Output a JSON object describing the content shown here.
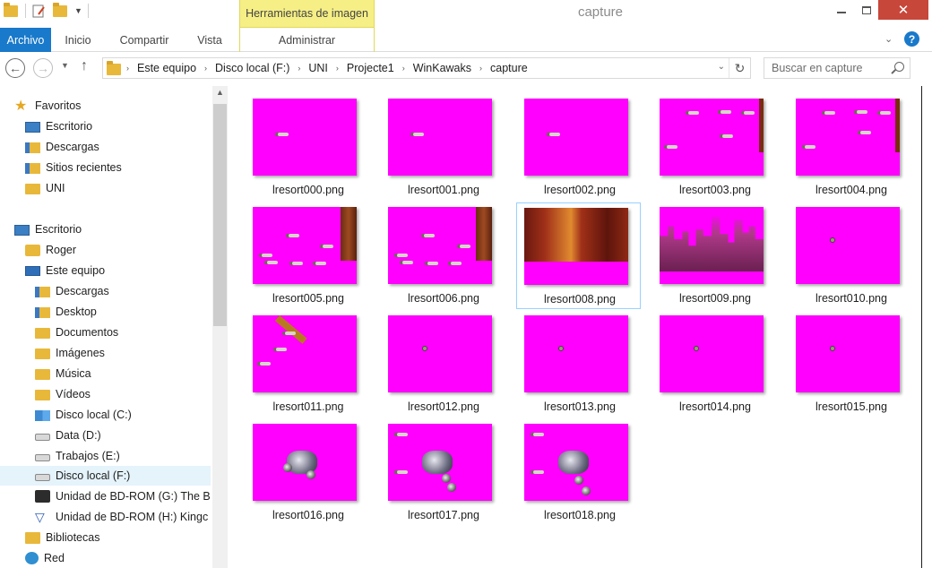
{
  "window": {
    "title": "capture",
    "context_tab_header": "Herramientas de imagen"
  },
  "ribbon": {
    "tabs": [
      "Archivo",
      "Inicio",
      "Compartir",
      "Vista",
      "Administrar"
    ]
  },
  "address_bar": {
    "crumbs": [
      "Este equipo",
      "Disco local (F:)",
      "UNI",
      "Projecte1",
      "WinKawaks",
      "capture"
    ]
  },
  "search": {
    "placeholder": "Buscar en capture"
  },
  "navigation": {
    "items": [
      {
        "label": "Favoritos",
        "icon": "star-icon"
      },
      {
        "label": "Escritorio",
        "icon": "desktop-icon"
      },
      {
        "label": "Descargas",
        "icon": "downloads-folder-icon"
      },
      {
        "label": "Sitios recientes",
        "icon": "recent-places-icon"
      },
      {
        "label": "UNI",
        "icon": "folder-icon"
      },
      {
        "label": "Escritorio",
        "icon": "desktop-icon"
      },
      {
        "label": "Roger",
        "icon": "user-folder-icon"
      },
      {
        "label": "Este equipo",
        "icon": "computer-icon"
      },
      {
        "label": "Descargas",
        "icon": "downloads-folder-icon"
      },
      {
        "label": "Desktop",
        "icon": "desktop-folder-icon"
      },
      {
        "label": "Documentos",
        "icon": "documents-folder-icon"
      },
      {
        "label": "Imágenes",
        "icon": "pictures-folder-icon"
      },
      {
        "label": "Música",
        "icon": "music-folder-icon"
      },
      {
        "label": "Vídeos",
        "icon": "videos-folder-icon"
      },
      {
        "label": "Disco local (C:)",
        "icon": "windows-drive-icon"
      },
      {
        "label": "Data (D:)",
        "icon": "drive-icon"
      },
      {
        "label": "Trabajos (E:)",
        "icon": "drive-icon"
      },
      {
        "label": "Disco local (F:)",
        "icon": "drive-icon"
      },
      {
        "label": "Unidad de BD-ROM (G:) The B",
        "icon": "bd-rom-icon"
      },
      {
        "label": "Unidad de BD-ROM (H:) Kingc",
        "icon": "bd-rom-icon"
      },
      {
        "label": "Bibliotecas",
        "icon": "libraries-icon"
      },
      {
        "label": "Red",
        "icon": "network-icon"
      }
    ]
  },
  "files": [
    {
      "name": "lresort000.png"
    },
    {
      "name": "lresort001.png"
    },
    {
      "name": "lresort002.png"
    },
    {
      "name": "lresort003.png"
    },
    {
      "name": "lresort004.png"
    },
    {
      "name": "lresort005.png"
    },
    {
      "name": "lresort006.png"
    },
    {
      "name": "lresort008.png"
    },
    {
      "name": "lresort009.png"
    },
    {
      "name": "lresort010.png"
    },
    {
      "name": "lresort011.png"
    },
    {
      "name": "lresort012.png"
    },
    {
      "name": "lresort013.png"
    },
    {
      "name": "lresort014.png"
    },
    {
      "name": "lresort015.png"
    },
    {
      "name": "lresort016.png"
    },
    {
      "name": "lresort017.png"
    },
    {
      "name": "lresort018.png"
    }
  ],
  "colors": {
    "accent": "#1979ca",
    "context_tab": "#f6ef86",
    "thumbnail_bg": "#ff00ff",
    "close_button": "#c7473a",
    "selection": "#99d1ff"
  }
}
